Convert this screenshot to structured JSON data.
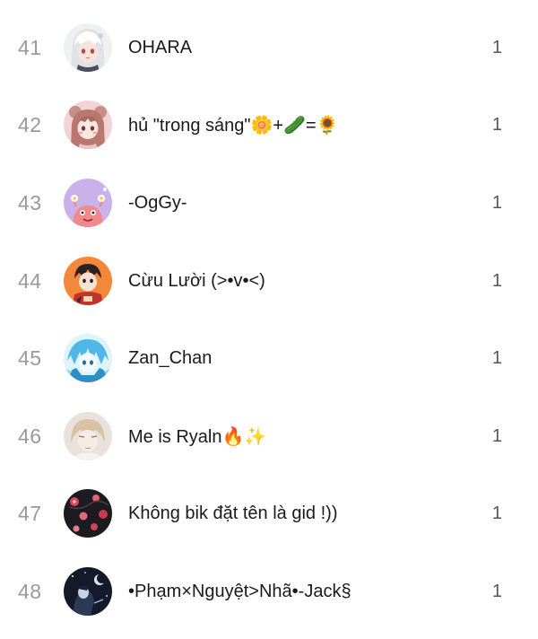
{
  "leaderboard": {
    "rows": [
      {
        "rank": "41",
        "name": "OHARA",
        "count": "1",
        "avatar": "avatar-anime-white-hair"
      },
      {
        "rank": "42",
        "name": "hủ \"trong sáng\"🌼+🥒=🌻",
        "count": "1",
        "avatar": "avatar-anime-pink-bear"
      },
      {
        "rank": "43",
        "name": "-OgGy-",
        "count": "1",
        "avatar": "avatar-purple-cartoon"
      },
      {
        "rank": "44",
        "name": "Cừu Lười (>•v•<)",
        "count": "1",
        "avatar": "avatar-orange-anime-boy"
      },
      {
        "rank": "45",
        "name": "Zan_Chan",
        "count": "1",
        "avatar": "avatar-blue-hair-anime"
      },
      {
        "rank": "46",
        "name": "Me is Ryaln🔥✨",
        "count": "1",
        "avatar": "avatar-blonde-boy"
      },
      {
        "rank": "47",
        "name": "Không bik đặt tên là gid !))",
        "count": "1",
        "avatar": "avatar-dark-flowers"
      },
      {
        "rank": "48",
        "name": "•Phạm×Nguyệt>Nhã•-Jack§",
        "count": "1",
        "avatar": "avatar-dark-night"
      }
    ]
  }
}
